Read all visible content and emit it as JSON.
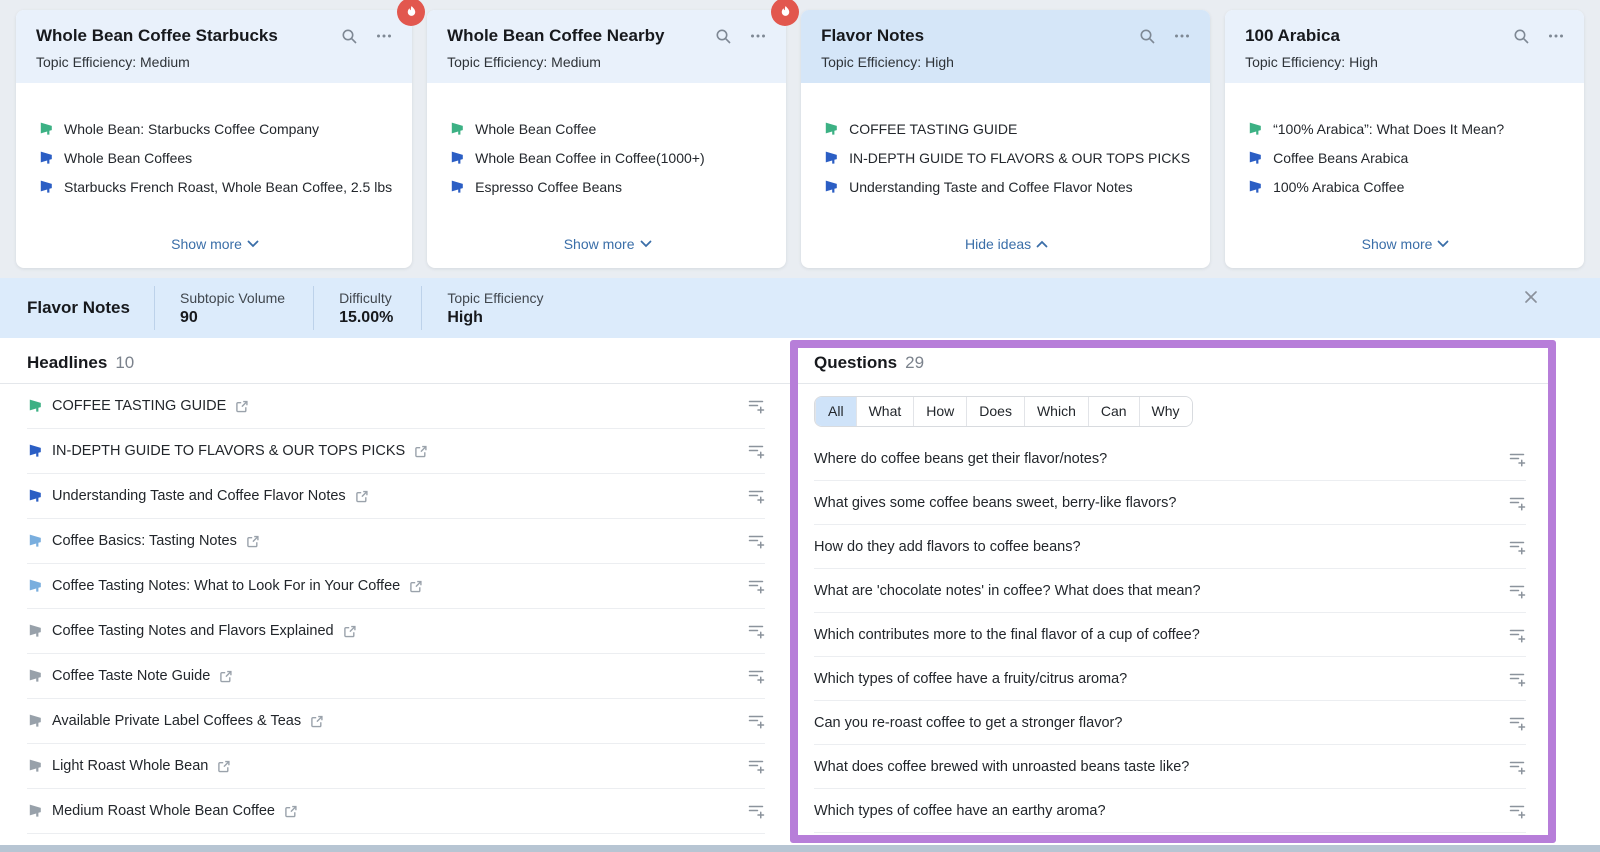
{
  "colors": {
    "accent_link": "#3a6ea8",
    "card_header": "#e9f1fb",
    "selected_card_header": "#d5e6f8",
    "detail_bar": "#dcebfb",
    "highlight_purple": "#b77ed9",
    "flame_badge": "#e2574e",
    "icon_green": "#3cb184",
    "icon_blue": "#2b5ec4",
    "icon_lightblue": "#79aede",
    "icon_gray": "#98a1aa"
  },
  "icons": {
    "search-icon": "magnifier",
    "more-options-icon": "ellipsis",
    "flame-icon": "flame",
    "megaphone-icon": "megaphone",
    "external-link-icon": "arrow-out-of-box",
    "add-to-list-icon": "lines-with-plus",
    "chevron-down-icon": "chevron",
    "close-icon": "x-cross"
  },
  "cards": [
    {
      "title": "Whole Bean Coffee Starbucks",
      "efficiency_label": "Topic Efficiency:",
      "efficiency_value": "Medium",
      "flame": true,
      "selected": false,
      "ideas": [
        {
          "text": "Whole Bean: Starbucks Coffee Company",
          "color": "green"
        },
        {
          "text": "Whole Bean Coffees",
          "color": "blue"
        },
        {
          "text": "Starbucks French Roast, Whole Bean Coffee, 2.5 lbs",
          "color": "blue"
        }
      ],
      "footer": {
        "label": "Show more",
        "chevron": "down"
      }
    },
    {
      "title": "Whole Bean Coffee Nearby",
      "efficiency_label": "Topic Efficiency:",
      "efficiency_value": "Medium",
      "flame": true,
      "selected": false,
      "ideas": [
        {
          "text": "Whole Bean Coffee",
          "color": "green"
        },
        {
          "text": "Whole Bean Coffee in Coffee(1000+)",
          "color": "blue"
        },
        {
          "text": "Espresso Coffee Beans",
          "color": "blue"
        }
      ],
      "footer": {
        "label": "Show more",
        "chevron": "down"
      }
    },
    {
      "title": "Flavor Notes",
      "efficiency_label": "Topic Efficiency:",
      "efficiency_value": "High",
      "flame": false,
      "selected": true,
      "ideas": [
        {
          "text": "COFFEE TASTING GUIDE",
          "color": "green"
        },
        {
          "text": "IN-DEPTH GUIDE TO FLAVORS & OUR TOPS PICKS",
          "color": "blue"
        },
        {
          "text": "Understanding Taste and Coffee Flavor Notes",
          "color": "blue"
        }
      ],
      "footer": {
        "label": "Hide ideas",
        "chevron": "up"
      }
    },
    {
      "title": "100 Arabica",
      "efficiency_label": "Topic Efficiency:",
      "efficiency_value": "High",
      "flame": false,
      "selected": false,
      "ideas": [
        {
          "text": "“100% Arabica”: What Does It Mean?",
          "color": "green"
        },
        {
          "text": "Coffee Beans Arabica",
          "color": "blue"
        },
        {
          "text": "100% Arabica Coffee",
          "color": "blue"
        }
      ],
      "footer": {
        "label": "Show more",
        "chevron": "down"
      }
    }
  ],
  "detail": {
    "title": "Flavor Notes",
    "metrics": [
      {
        "label": "Subtopic Volume",
        "value": "90"
      },
      {
        "label": "Difficulty",
        "value": "15.00%"
      },
      {
        "label": "Topic Efficiency",
        "value": "High"
      }
    ]
  },
  "headlines": {
    "title": "Headlines",
    "count": "10",
    "items": [
      {
        "text": "COFFEE TASTING GUIDE",
        "icon": "green"
      },
      {
        "text": "IN-DEPTH GUIDE TO FLAVORS & OUR TOPS PICKS",
        "icon": "blue"
      },
      {
        "text": "Understanding Taste and Coffee Flavor Notes",
        "icon": "blue"
      },
      {
        "text": "Coffee Basics: Tasting Notes",
        "icon": "lightblue"
      },
      {
        "text": "Coffee Tasting Notes: What to Look For in Your Coffee",
        "icon": "lightblue"
      },
      {
        "text": "Coffee Tasting Notes and Flavors Explained",
        "icon": "gray"
      },
      {
        "text": "Coffee Taste Note Guide",
        "icon": "gray"
      },
      {
        "text": "Available Private Label Coffees & Teas",
        "icon": "gray"
      },
      {
        "text": "Light Roast Whole Bean",
        "icon": "gray"
      },
      {
        "text": "Medium Roast Whole Bean Coffee",
        "icon": "gray"
      }
    ]
  },
  "questions": {
    "title": "Questions",
    "count": "29",
    "filters": [
      {
        "label": "All",
        "active": true
      },
      {
        "label": "What",
        "active": false
      },
      {
        "label": "How",
        "active": false
      },
      {
        "label": "Does",
        "active": false
      },
      {
        "label": "Which",
        "active": false
      },
      {
        "label": "Can",
        "active": false
      },
      {
        "label": "Why",
        "active": false
      }
    ],
    "items": [
      "Where do coffee beans get their flavor/notes?",
      "What gives some coffee beans sweet, berry-like flavors?",
      "How do they add flavors to coffee beans?",
      "What are 'chocolate notes' in coffee? What does that mean?",
      "Which contributes more to the final flavor of a cup of coffee?",
      "Which types of coffee have a fruity/citrus aroma?",
      "Can you re-roast coffee to get a stronger flavor?",
      "What does coffee brewed with unroasted beans taste like?",
      "Which types of coffee have an earthy aroma?"
    ]
  }
}
